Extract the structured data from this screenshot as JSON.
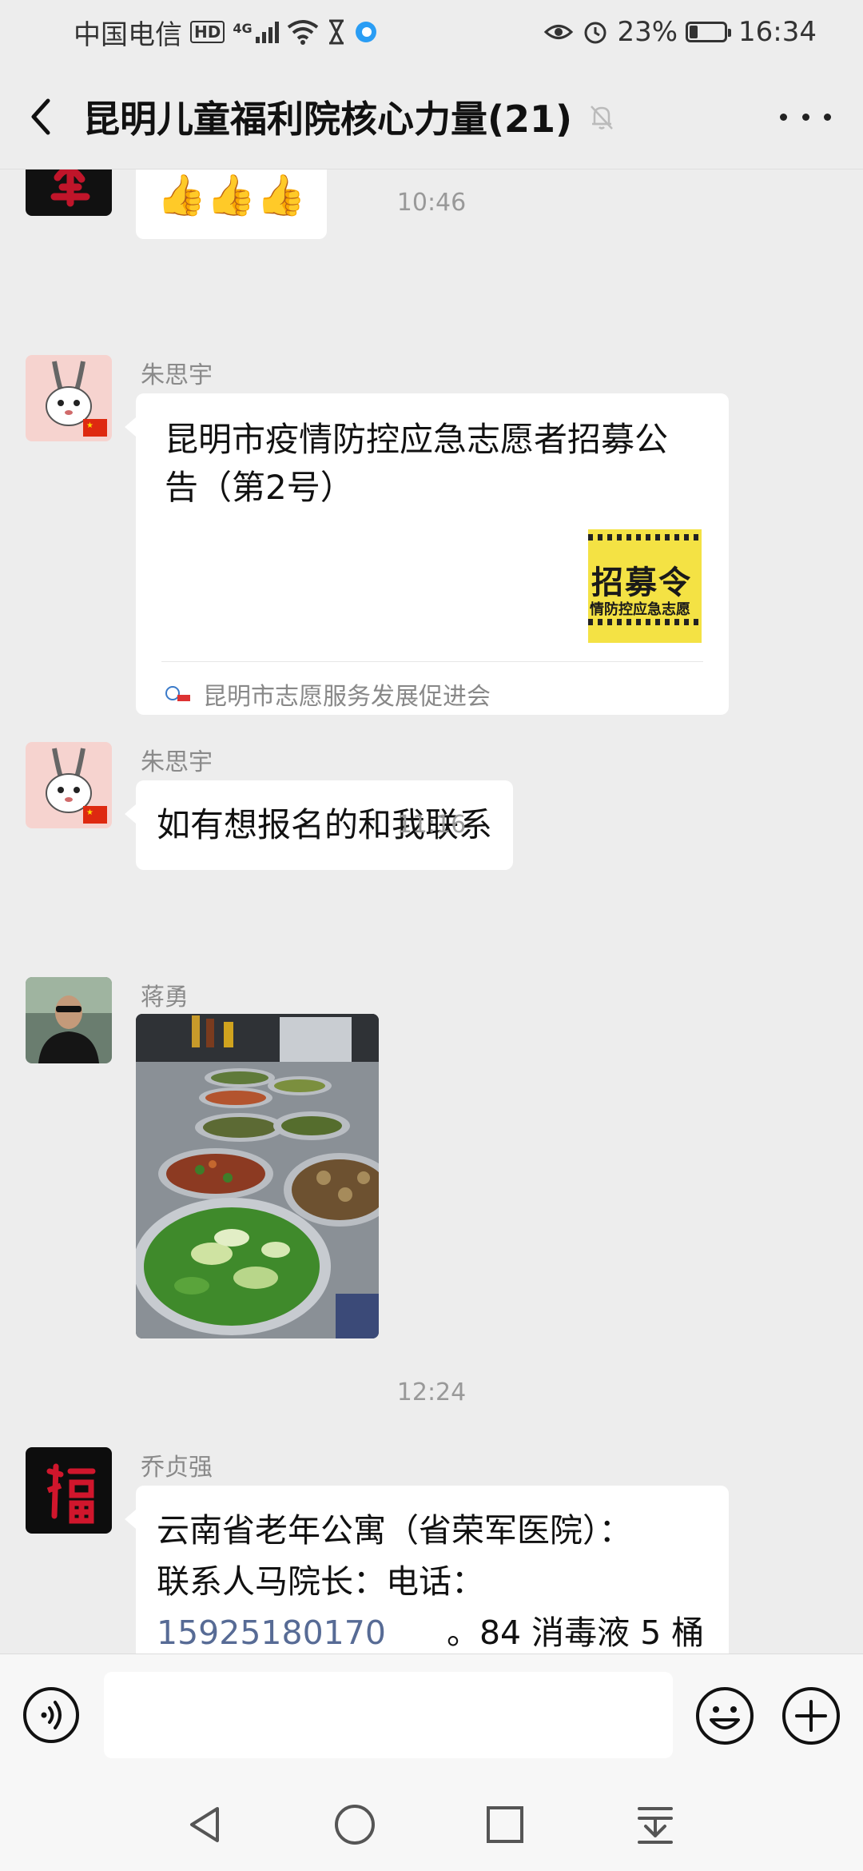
{
  "status_bar": {
    "carrier": "中国电信",
    "hd": "HD",
    "network": "4G",
    "battery_percent": "23%",
    "battery_level": 0.23,
    "time": "16:34"
  },
  "header": {
    "title": "昆明儿童福利院核心力量(21)",
    "icons": [
      "back-arrow-icon",
      "mute-bell-icon",
      "more-dots-icon"
    ]
  },
  "messages": {
    "top_emoji": "👍👍👍",
    "ts1": "10:46",
    "msg1": {
      "sender": "朱思宇",
      "card_title": "昆明市疫情防控应急志愿者招募公告（第2号）",
      "thumb_main": "招募令",
      "thumb_sub": "情防控应急志愿",
      "source": "昆明市志愿服务发展促进会"
    },
    "msg2": {
      "sender": "朱思宇",
      "text": "如有想报名的和我联系"
    },
    "ts2": "11:16",
    "msg3": {
      "sender": "蒋勇"
    },
    "ts3": "12:24",
    "msg4": {
      "sender": "乔贞强",
      "line1": "云南省老年公寓（省荣军医院）：",
      "line2": "联系人马院长：电话：",
      "phone": "15925180170",
      "line3_rest": "。84 消毒液 5 桶"
    }
  },
  "input": {
    "placeholder": ""
  },
  "colors": {
    "background": "#ededed",
    "bubble": "#ffffff",
    "link": "#576b95",
    "timestamp": "#999999"
  }
}
